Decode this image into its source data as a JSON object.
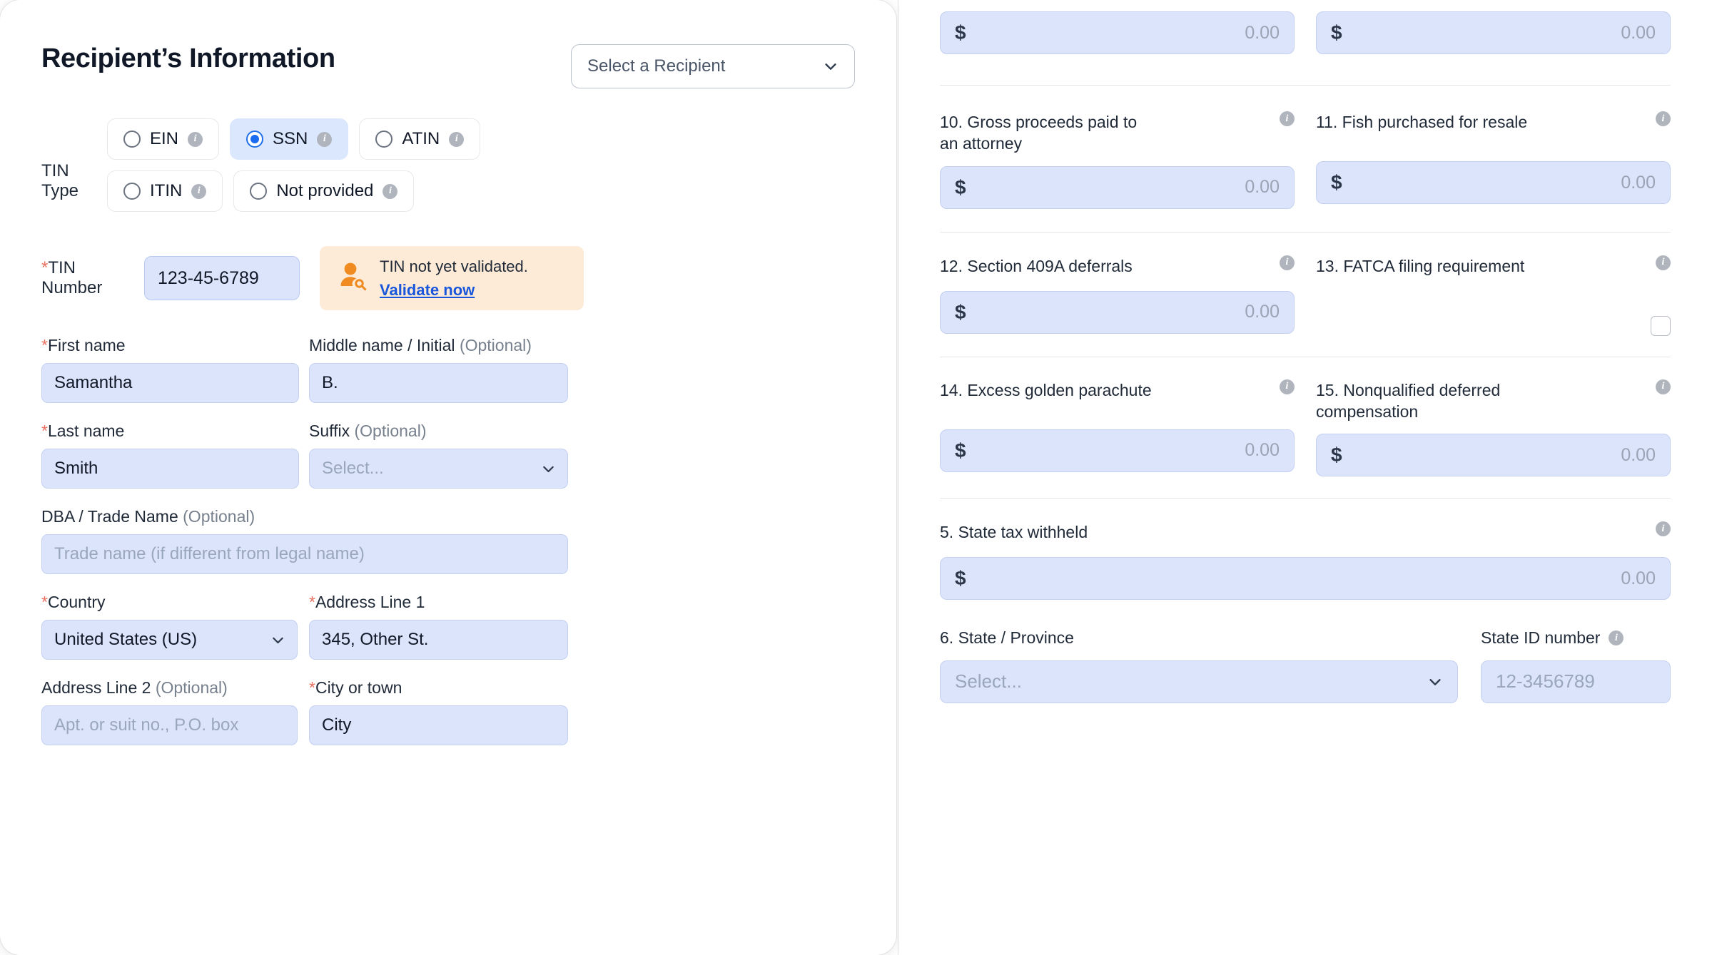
{
  "left": {
    "title": "Recipient’s Information",
    "recipient_select": {
      "value": "Select a Recipient",
      "icon": "chevron-down-icon"
    },
    "tin_type": {
      "label": "TIN Type",
      "options": [
        {
          "label": "EIN",
          "selected": false
        },
        {
          "label": "SSN",
          "selected": true
        },
        {
          "label": "ATIN",
          "selected": false
        },
        {
          "label": "ITIN",
          "selected": false
        },
        {
          "label": "Not provided",
          "selected": false
        }
      ]
    },
    "tin_number": {
      "label": "TIN Number",
      "required": true,
      "value": "123-45-6789"
    },
    "validation": {
      "icon": "user-search-icon",
      "message": "TIN not yet validated.",
      "link": "Validate now"
    },
    "fields": {
      "first_name": {
        "label": "First name",
        "required": true,
        "value": "Samantha"
      },
      "middle_name": {
        "label": "Middle name / Initial",
        "optional": "(Optional)",
        "value": "B."
      },
      "last_name": {
        "label": "Last name",
        "required": true,
        "value": "Smith"
      },
      "suffix": {
        "label": "Suffix",
        "optional": "(Optional)",
        "placeholder": "Select..."
      },
      "dba": {
        "label": "DBA / Trade Name",
        "optional": "(Optional)",
        "placeholder": "Trade name (if different from legal name)"
      },
      "country": {
        "label": "Country",
        "required": true,
        "value": "United States (US)"
      },
      "address1": {
        "label": "Address Line 1",
        "required": true,
        "value": "345, Other St."
      },
      "address2": {
        "label": "Address Line 2",
        "optional": "(Optional)",
        "placeholder": "Apt. or suit no., P.O. box"
      },
      "city": {
        "label": "City or town",
        "required": true,
        "value": "City"
      }
    }
  },
  "right": {
    "top_money": [
      {
        "dollar": "$",
        "amount": "0.00"
      },
      {
        "dollar": "$",
        "amount": "0.00"
      }
    ],
    "boxes": [
      {
        "left": {
          "label": "10. Gross proceeds paid to an attorney",
          "dollar": "$",
          "amount": "0.00",
          "info": "info-icon"
        },
        "right": {
          "label": "11. Fish purchased for resale",
          "dollar": "$",
          "amount": "0.00",
          "info": "info-icon"
        }
      },
      {
        "left": {
          "label": "12. Section 409A deferrals",
          "dollar": "$",
          "amount": "0.00",
          "info": "info-icon"
        },
        "right": {
          "label": "13. FATCA filing requirement",
          "type": "checkbox",
          "checked": false,
          "info": "info-icon"
        }
      },
      {
        "left": {
          "label": "14. Excess golden parachute",
          "dollar": "$",
          "amount": "0.00",
          "info": "info-icon"
        },
        "right": {
          "label": "15. Nonqualified deferred compensation",
          "dollar": "$",
          "amount": "0.00",
          "info": "info-icon"
        }
      }
    ],
    "state_tax": {
      "label": "5. State tax withheld",
      "dollar": "$",
      "amount": "0.00",
      "info": "info-icon"
    },
    "state_province": {
      "label": "6. State / Province",
      "placeholder": "Select..."
    },
    "state_id": {
      "label": "State ID number",
      "placeholder": "12-3456789",
      "info": "info-icon"
    }
  },
  "colors": {
    "input_bg": "#dbe4fb",
    "input_border": "#c3d0f0",
    "selected_option_bg": "#dbe7fd",
    "radio_accent": "#1a6cf0",
    "validate_bg": "#fdebd7",
    "link": "#1a56db",
    "required_star": "#e8705f",
    "info_icon": "#b0b5bd",
    "orange_icon": "#ef8b21"
  }
}
